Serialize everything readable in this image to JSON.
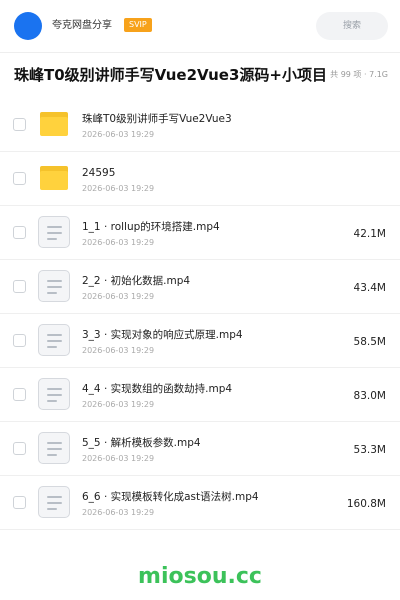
{
  "header": {
    "owner_name": "夸克网盘分享",
    "badge": "SVIP",
    "search_placeholder": "搜索"
  },
  "folder": {
    "title": "珠峰T0级别讲师手写Vue2Vue3源码+小项目",
    "item_count": "共 99 项",
    "total_size": "7.1G"
  },
  "files": [
    {
      "type": "folder",
      "icon": "folder-icon",
      "name": "珠峰T0级别讲师手写Vue2Vue3",
      "date": "2026-06-03 19:29",
      "size": ""
    },
    {
      "type": "folder",
      "icon": "folder-icon",
      "name": "24595",
      "date": "2026-06-03 19:29",
      "size": ""
    },
    {
      "type": "file",
      "icon": "document-icon",
      "name": "1_1 · rollup的环境搭建.mp4",
      "date": "2026-06-03 19:29",
      "size": "42.1M"
    },
    {
      "type": "file",
      "icon": "document-icon",
      "name": "2_2 · 初始化数据.mp4",
      "date": "2026-06-03 19:29",
      "size": "43.4M"
    },
    {
      "type": "file",
      "icon": "document-icon",
      "name": "3_3 · 实现对象的响应式原理.mp4",
      "date": "2026-06-03 19:29",
      "size": "58.5M"
    },
    {
      "type": "file",
      "icon": "document-icon",
      "name": "4_4 · 实现数组的函数劫持.mp4",
      "date": "2026-06-03 19:29",
      "size": "83.0M"
    },
    {
      "type": "file",
      "icon": "document-icon",
      "name": "5_5 · 解析模板参数.mp4",
      "date": "2026-06-03 19:29",
      "size": "53.3M"
    },
    {
      "type": "file",
      "icon": "document-icon",
      "name": "6_6 · 实现模板转化成ast语法树.mp4",
      "date": "2026-06-03 19:29",
      "size": "160.8M"
    }
  ],
  "watermark": "miosou.cc",
  "colors": {
    "accent": "#1a73f0",
    "badge": "#f7a21b",
    "folder": "#ffd23d",
    "watermark": "#3cc25a"
  }
}
